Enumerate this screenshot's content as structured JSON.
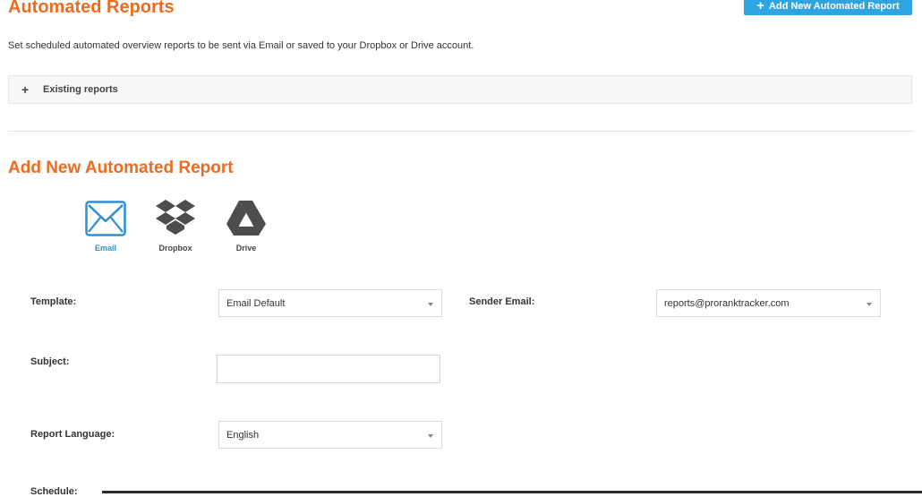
{
  "header": {
    "title": "Automated Reports",
    "add_button_label": "Add New Automated Report",
    "description": "Set scheduled automated overview reports to be sent via Email or saved to your Dropbox or Drive account."
  },
  "existing_reports": {
    "label": "Existing reports",
    "toggle_icon": "+"
  },
  "form": {
    "title": "Add New Automated Report",
    "destinations": [
      {
        "label": "Email",
        "icon": "envelope-icon",
        "selected": true
      },
      {
        "label": "Dropbox",
        "icon": "dropbox-icon",
        "selected": false
      },
      {
        "label": "Drive",
        "icon": "drive-icon",
        "selected": false
      }
    ],
    "template": {
      "label": "Template:",
      "value": "Email Default"
    },
    "sender_email": {
      "label": "Sender Email:",
      "value": "reports@proranktracker.com"
    },
    "subject": {
      "label": "Subject:",
      "value": ""
    },
    "report_language": {
      "label": "Report Language:",
      "value": "English"
    },
    "schedule": {
      "label": "Schedule:"
    }
  },
  "colors": {
    "accent_orange": "#ee6b1f",
    "button_blue": "#2ea4e0",
    "selected_blue": "#2e8fd4",
    "icon_gray": "#4d4d4d"
  }
}
